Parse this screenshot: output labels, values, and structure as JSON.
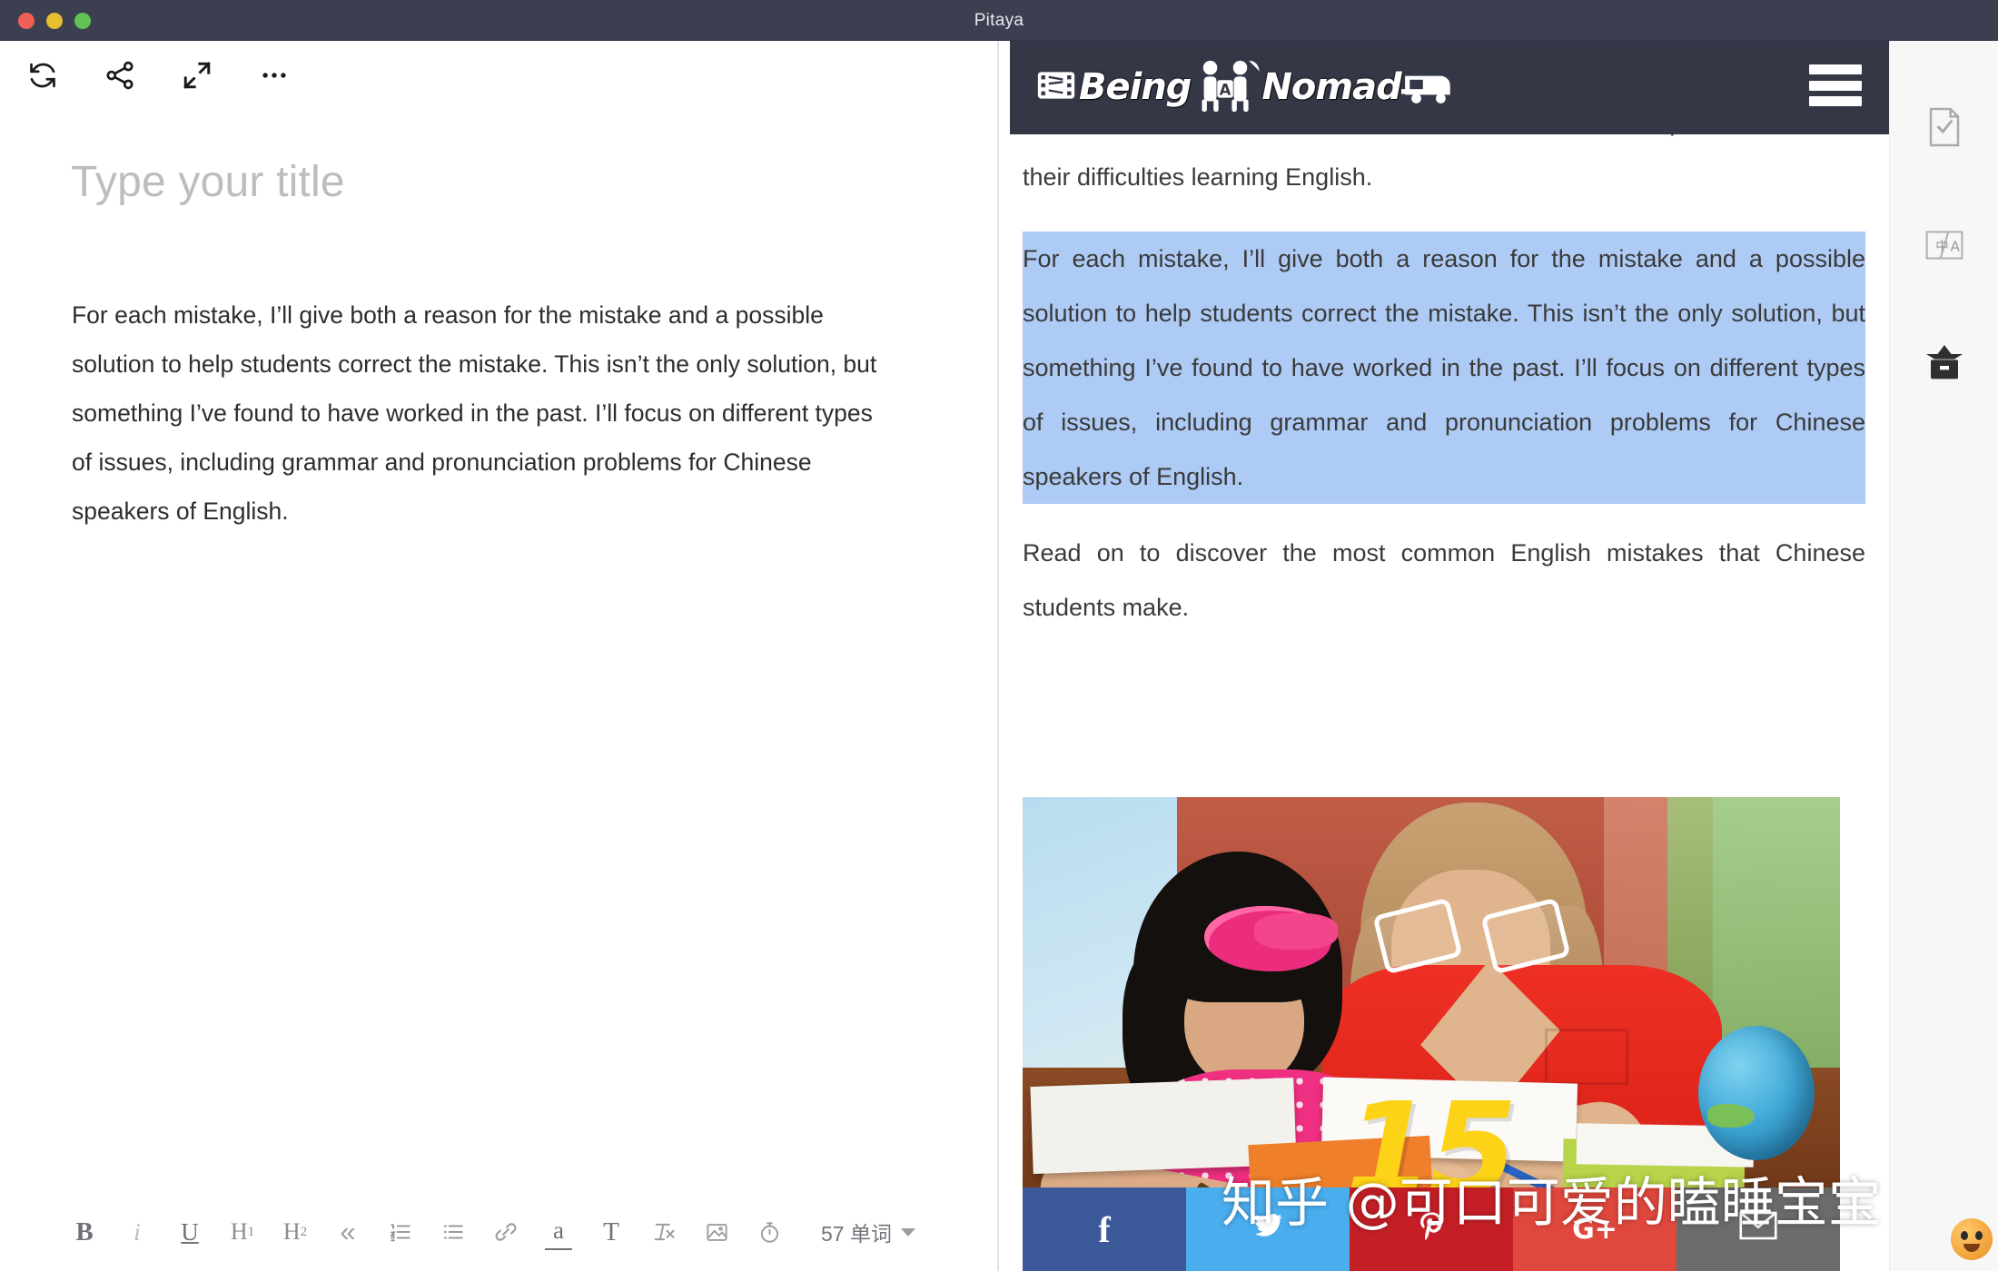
{
  "window": {
    "title": "Pitaya",
    "traffic_lights": [
      "close-red",
      "minimize-yellow",
      "zoom-green"
    ],
    "colors": {
      "titlebar_bg": "#3c3f50",
      "selection_highlight": "#aecbf5",
      "web_header_bg": "#343746"
    }
  },
  "editor": {
    "toolbar": [
      {
        "name": "refresh-icon",
        "label": "Refresh"
      },
      {
        "name": "share-icon",
        "label": "Share"
      },
      {
        "name": "fullscreen-icon",
        "label": "Fullscreen"
      },
      {
        "name": "more-icon",
        "label": "More"
      }
    ],
    "title_placeholder": "Type your title",
    "body": "For each mistake, I’ll give both a reason for the mistake and a possible solution to help students correct the mistake. This isn’t the only solution, but something I’ve found to have worked in the past. I’ll focus on different types of issues, including grammar and pronunciation problems for Chinese speakers of English.",
    "format_bar": {
      "bold": "B",
      "italic": "i",
      "underline": "U",
      "heading1": "H",
      "heading1_sub": "1",
      "heading2": "H",
      "heading2_sub": "2",
      "quote": "«",
      "ordered_list": "ordered-list-icon",
      "bullet_list": "bullet-list-icon",
      "link": "link-icon",
      "highlight": "a",
      "text_style": "T",
      "clear_format": "clear-format-icon",
      "image": "image-icon",
      "timer": "timer-icon",
      "word_count": "57 单词"
    }
  },
  "web_preview": {
    "site_brand": "Being A Nomad",
    "brand_parts": {
      "first": "Being",
      "second": "Nomad",
      "middle_letter": "A"
    },
    "menu": "hamburger-menu",
    "paragraphs": [
      {
        "id": "p-top",
        "text": "...to Chinese students. But students can use it well to help them overcome their difficulties learning English.",
        "selected": false
      },
      {
        "id": "p-selected",
        "text": "For each mistake, I’ll give both a reason for the mistake and a possible solution to help students correct the mistake. This isn’t the only solution, but something I’ve found to have worked in the past. I’ll focus on different types of issues, including grammar and pronunciation problems for Chinese speakers of English.",
        "selected": true
      },
      {
        "id": "p-readon",
        "text": "Read on to discover the most common English mistakes that Chinese students make.",
        "selected": false
      }
    ],
    "image": {
      "name": "teacher-and-student-photo",
      "alt": "Teacher in red shirt helping a young girl in pink with schoolwork at a desk with a globe",
      "overlay_number": "15"
    },
    "social_buttons": [
      {
        "name": "facebook-share-button",
        "glyph": "f",
        "color": "#3b5998"
      },
      {
        "name": "twitter-share-button",
        "glyph": "twitter-icon",
        "color": "#4aaded"
      },
      {
        "name": "pinterest-share-button",
        "glyph": "pinterest-icon",
        "color": "#c41f26"
      },
      {
        "name": "googleplus-share-button",
        "glyph": "G+",
        "color": "#e0483d"
      },
      {
        "name": "email-share-button",
        "glyph": "envelope-icon",
        "color": "#6b6b6b"
      }
    ]
  },
  "right_rail": [
    {
      "name": "document-check-icon",
      "label": "Proofread"
    },
    {
      "name": "translate-icon",
      "label": "中/A"
    },
    {
      "name": "archive-box-icon",
      "label": "Archive"
    }
  ],
  "watermark": {
    "text": "知乎 @可口可爱的瞌睡宝宝"
  }
}
